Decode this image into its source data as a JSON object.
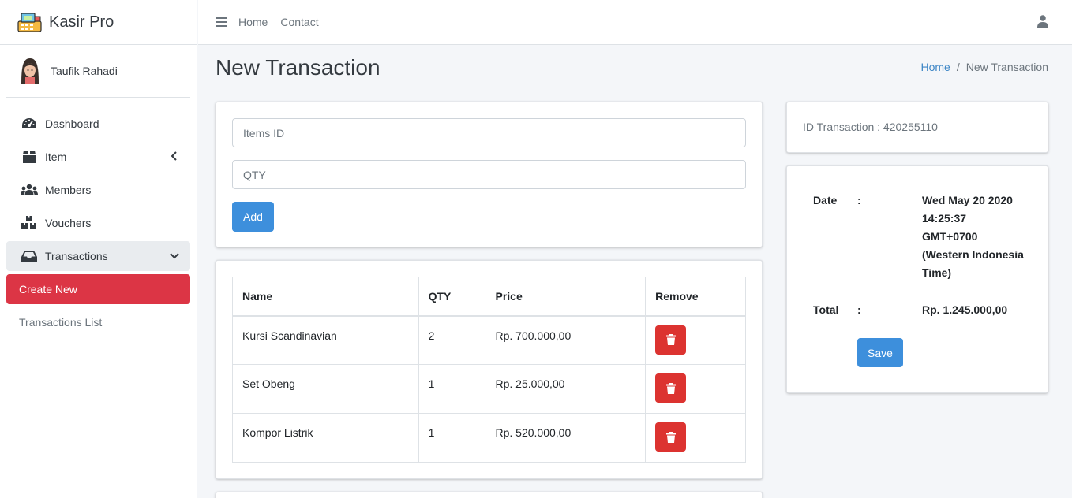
{
  "brand": {
    "name": "Kasir Pro"
  },
  "user": {
    "name": "Taufik Rahadi"
  },
  "sidebar": {
    "items": [
      {
        "label": "Dashboard",
        "icon": "dashboard-icon"
      },
      {
        "label": "Item",
        "icon": "box-icon"
      },
      {
        "label": "Members",
        "icon": "users-icon"
      },
      {
        "label": "Vouchers",
        "icon": "boxes-icon"
      },
      {
        "label": "Transactions",
        "icon": "inbox-icon"
      }
    ],
    "subitems": [
      {
        "label": "Create New"
      },
      {
        "label": "Transactions List"
      }
    ]
  },
  "topbar": {
    "home": "Home",
    "contact": "Contact"
  },
  "page": {
    "title": "New Transaction",
    "breadcrumb": {
      "home": "Home",
      "separator": "/",
      "current": "New Transaction"
    }
  },
  "form": {
    "items_id_placeholder": "Items ID",
    "qty_placeholder": "QTY",
    "add_label": "Add"
  },
  "table": {
    "headers": [
      "Name",
      "QTY",
      "Price",
      "Remove"
    ],
    "rows": [
      {
        "name": "Kursi Scandinavian",
        "qty": "2",
        "price": "Rp. 700.000,00"
      },
      {
        "name": "Set Obeng",
        "qty": "1",
        "price": "Rp. 25.000,00"
      },
      {
        "name": "Kompor Listrik",
        "qty": "1",
        "price": "Rp. 520.000,00"
      }
    ]
  },
  "summary": {
    "id_transaction": "ID Transaction : 420255110",
    "date_label": "Date",
    "colon": ":",
    "date_lines": [
      "Wed May 20 2020",
      "14:25:37",
      "GMT+0700",
      "(Western Indonesia",
      "Time)"
    ],
    "total_label": "Total",
    "total_value": "Rp. 1.245.000,00",
    "save_label": "Save"
  },
  "colors": {
    "primary": "#3d8fdc",
    "danger": "#dc3545",
    "link": "#3d86c6"
  }
}
